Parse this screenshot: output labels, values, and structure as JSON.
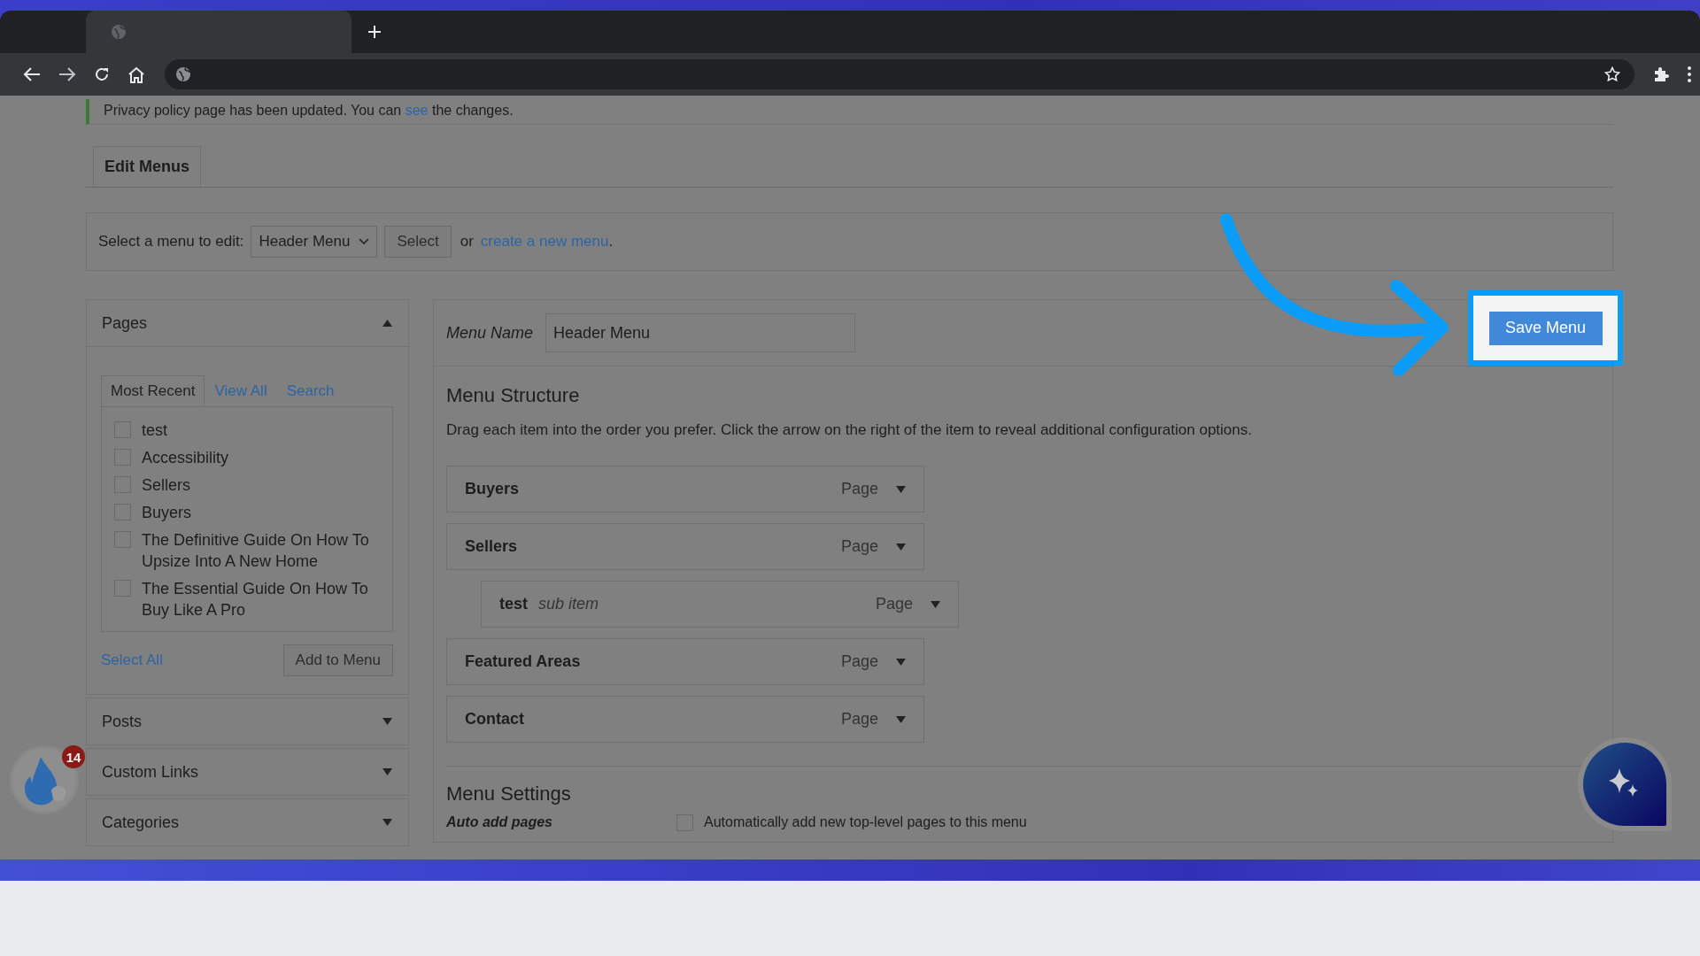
{
  "notice": {
    "before": "Privacy policy page has been updated. You can",
    "link": "see",
    "after": "the changes."
  },
  "tabs": [
    {
      "label": "Edit Menus",
      "selected": true
    }
  ],
  "menu_select": {
    "label": "Select a menu to edit:",
    "value": "Header Menu",
    "button": "Select",
    "or_text": "or",
    "link": "create a new menu",
    "after": "."
  },
  "pages_box": {
    "title": "Pages",
    "expanded": true,
    "tabs": [
      {
        "label": "Most Recent",
        "selected": true
      },
      {
        "label": "View All",
        "selected": false
      },
      {
        "label": "Search",
        "selected": false
      }
    ],
    "items": [
      {
        "label": "test",
        "checked": false
      },
      {
        "label": "Accessibility",
        "checked": false
      },
      {
        "label": "Sellers",
        "checked": false
      },
      {
        "label": "Buyers",
        "checked": false
      },
      {
        "label": "The Definitive Guide On How To Upsize Into A New Home",
        "checked": false
      },
      {
        "label": "The Essential Guide On How To Buy Like A Pro",
        "checked": false
      }
    ],
    "select_all": "Select All",
    "add_button": "Add to Menu"
  },
  "other_boxes": [
    {
      "title": "Posts",
      "expanded": false
    },
    {
      "title": "Custom Links",
      "expanded": false
    },
    {
      "title": "Categories",
      "expanded": false
    }
  ],
  "menu_name": {
    "label": "Menu Name",
    "value": "Header Menu"
  },
  "save_button": "Save Menu",
  "structure": {
    "title": "Menu Structure",
    "description": "Drag each item into the order you prefer. Click the arrow on the right of the item to reveal additional configuration options.",
    "items": [
      {
        "title": "Buyers",
        "type": "Page"
      },
      {
        "title": "Sellers",
        "type": "Page",
        "children": [
          {
            "title": "test",
            "note": "sub item",
            "type": "Page"
          }
        ]
      },
      {
        "title": "Featured Areas",
        "type": "Page"
      },
      {
        "title": "Contact",
        "type": "Page"
      }
    ]
  },
  "settings": {
    "title": "Menu Settings",
    "label": "Auto add pages",
    "option": {
      "label": "Automatically add new top-level pages to this menu",
      "checked": false
    }
  },
  "notification_badge": "14"
}
